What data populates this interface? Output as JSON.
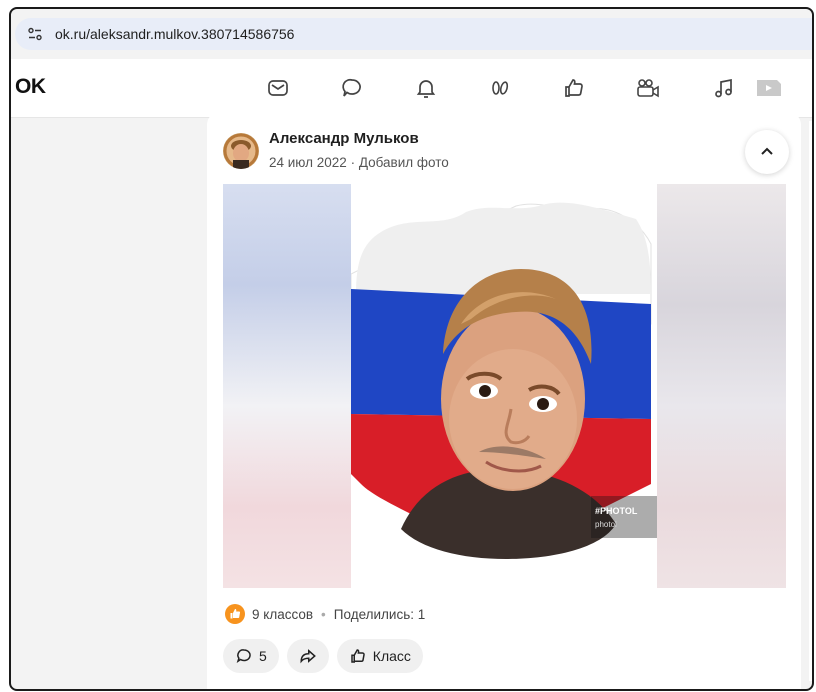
{
  "browser": {
    "url": "ok.ru/aleksandr.mulkov.380714586756",
    "site_settings_icon": "tune-icon"
  },
  "header": {
    "logo": "OK",
    "nav_icons": [
      "mail-icon",
      "discussions-icon",
      "notifications-icon",
      "guests-icon",
      "likes-icon",
      "video-icon",
      "music-icon",
      "apps-icon"
    ]
  },
  "post": {
    "author": "Александр Мульков",
    "date": "24 июл 2022",
    "separator": "·",
    "action": "Добавил фото",
    "photo_watermark": "#PHOTOL",
    "photo_watermark_sub": "photol",
    "likes_label": "9 классов",
    "shares_label": "Поделились: 1",
    "stats_separator": "•",
    "comments_count": "5",
    "klass_label": "Класс"
  },
  "colors": {
    "accent_orange": "#f7931e",
    "flag_white": "#ffffff",
    "flag_blue": "#1f46c4",
    "flag_red": "#d81e28"
  }
}
